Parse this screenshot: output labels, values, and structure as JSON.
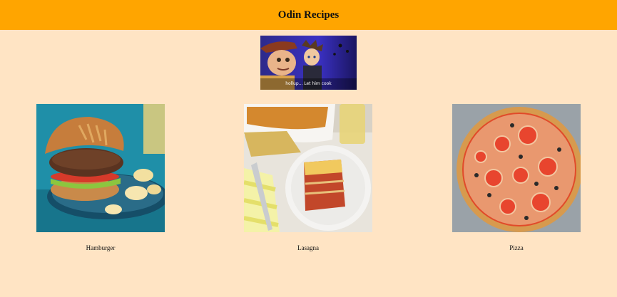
{
  "header": {
    "title": "Odin Recipes"
  },
  "meme": {
    "caption": "hollup... Let him cook"
  },
  "recipes": [
    {
      "name": "Hamburger"
    },
    {
      "name": "Lasagna"
    },
    {
      "name": "Pizza"
    }
  ]
}
